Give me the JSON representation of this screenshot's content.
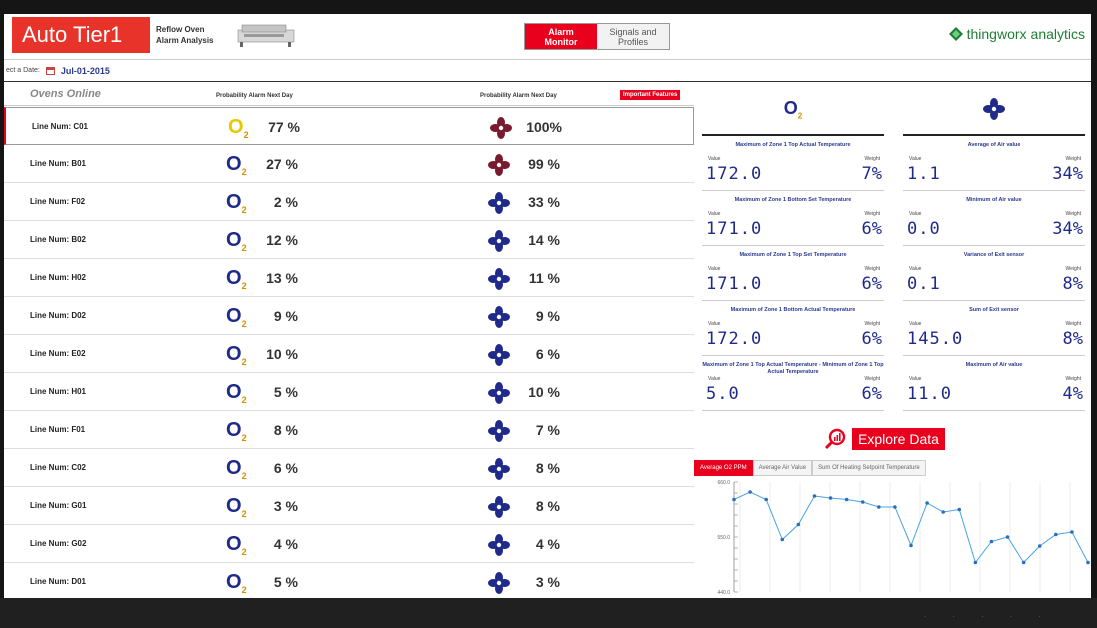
{
  "header": {
    "brand": "Auto Tier1",
    "subtitle_line1": "Reflow Oven",
    "subtitle_line2": "Alarm Analysis",
    "tab_active_line1": "Alarm",
    "tab_active_line2": "Monitor",
    "tab_inactive_line1": "Signals and",
    "tab_inactive_line2": "Profiles",
    "logo_thingworx": "thingworx",
    "logo_analytics": "analytics"
  },
  "datebar": {
    "label": "ect a Date:",
    "value": "Jul-01-2015"
  },
  "list": {
    "title": "Ovens Online",
    "col1_header": "Probability Alarm Next Day",
    "col2_header": "Probability Alarm Next Day",
    "important_features": "Important Features",
    "o2_symbol": "O",
    "o2_sub": "2",
    "rows": [
      {
        "line": "Line Num:  C01",
        "o2": "77 %",
        "fan": "100%",
        "o2_color": "yellow",
        "fan_color": "maroon"
      },
      {
        "line": "Line Num:  B01",
        "o2": "27 %",
        "fan": "99 %",
        "o2_color": "blue",
        "fan_color": "maroon"
      },
      {
        "line": "Line Num:  F02",
        "o2": "2 %",
        "fan": "33 %",
        "o2_color": "blue",
        "fan_color": "navy"
      },
      {
        "line": "Line Num:  B02",
        "o2": "12 %",
        "fan": "14 %",
        "o2_color": "blue",
        "fan_color": "navy"
      },
      {
        "line": "Line Num:  H02",
        "o2": "13 %",
        "fan": "11 %",
        "o2_color": "blue",
        "fan_color": "navy"
      },
      {
        "line": "Line Num:  D02",
        "o2": "9 %",
        "fan": "9 %",
        "o2_color": "blue",
        "fan_color": "navy"
      },
      {
        "line": "Line Num:  E02",
        "o2": "10 %",
        "fan": "6 %",
        "o2_color": "blue",
        "fan_color": "navy"
      },
      {
        "line": "Line Num:  H01",
        "o2": "5 %",
        "fan": "10 %",
        "o2_color": "blue",
        "fan_color": "navy"
      },
      {
        "line": "Line Num:  F01",
        "o2": "8 %",
        "fan": "7 %",
        "o2_color": "blue",
        "fan_color": "navy"
      },
      {
        "line": "Line Num:  C02",
        "o2": "6 %",
        "fan": "8 %",
        "o2_color": "blue",
        "fan_color": "navy"
      },
      {
        "line": "Line Num:  G01",
        "o2": "3 %",
        "fan": "8 %",
        "o2_color": "blue",
        "fan_color": "navy"
      },
      {
        "line": "Line Num:  G02",
        "o2": "4 %",
        "fan": "4 %",
        "o2_color": "blue",
        "fan_color": "navy"
      },
      {
        "line": "Line Num:  D01",
        "o2": "5 %",
        "fan": "3 %",
        "o2_color": "blue",
        "fan_color": "navy"
      }
    ]
  },
  "features": {
    "value_label": "Value",
    "weight_label": "Weight",
    "o2": [
      {
        "title": "Maximum of Zone 1 Top Actual Temperature",
        "value": "172.0",
        "weight": "7%"
      },
      {
        "title": "Maximum of Zone 1 Bottom Set Temperature",
        "value": "171.0",
        "weight": "6%"
      },
      {
        "title": "Maximum of Zone 1 Top Set Temperature",
        "value": "171.0",
        "weight": "6%"
      },
      {
        "title": "Maximum of Zone 1 Bottom Actual Temperature",
        "value": "172.0",
        "weight": "6%"
      },
      {
        "title": "Maximum of Zone 1 Top Actual Temperature - Minimum of Zone 1 Top Actual Temperature",
        "value": "5.0",
        "weight": "6%"
      }
    ],
    "air": [
      {
        "title": "Average of Air value",
        "value": "1.1",
        "weight": "34%"
      },
      {
        "title": "Minimum of Air value",
        "value": "0.0",
        "weight": "34%"
      },
      {
        "title": "Variance of Exit sensor",
        "value": "0.1",
        "weight": "8%"
      },
      {
        "title": "Sum of Exit sensor",
        "value": "145.0",
        "weight": "8%"
      },
      {
        "title": "Maximum of Air value",
        "value": "11.0",
        "weight": "4%"
      }
    ]
  },
  "explore": {
    "label": "Explore Data"
  },
  "chart_tabs": [
    "Average O2 PPM",
    "Average Air Value",
    "Sum Of Heating Setpoint Temperature"
  ],
  "colors": {
    "accent": "#e8001c",
    "navy": "#1f2a8a",
    "maroon": "#7a1a2e",
    "line": "#4aa3df"
  },
  "chart_data": {
    "type": "line",
    "series": [
      {
        "values": [
          625,
          640,
          625,
          545,
          575,
          632,
          628,
          625,
          620,
          610,
          610,
          533,
          618,
          600,
          605,
          499,
          541,
          550,
          499,
          532,
          555,
          560,
          499
        ]
      }
    ],
    "ylim": [
      440,
      660
    ],
    "yticks": [
      "660.0",
      "550.0",
      "440.0"
    ],
    "xlabel": "",
    "ylabel": ""
  }
}
